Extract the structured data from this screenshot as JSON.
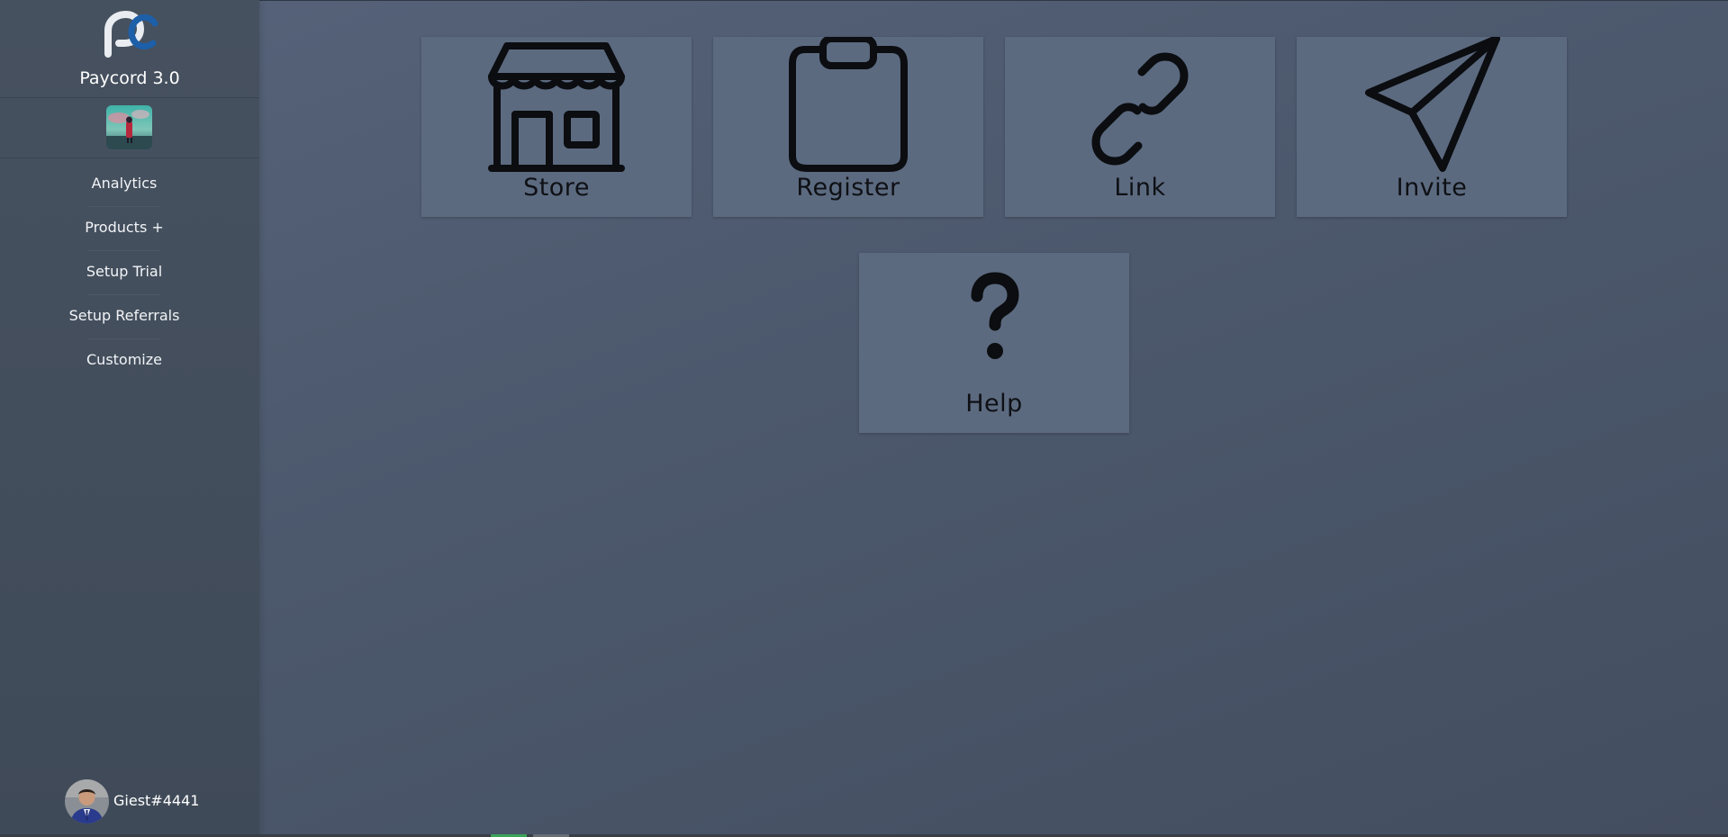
{
  "app": {
    "name": "Paycord 3.0"
  },
  "sidebar": {
    "items": [
      {
        "label": "Analytics"
      },
      {
        "label": "Products +"
      },
      {
        "label": "Setup Trial"
      },
      {
        "label": "Setup Referrals"
      },
      {
        "label": "Customize"
      }
    ]
  },
  "user": {
    "name": "Giest#4441"
  },
  "tiles": [
    {
      "label": "Store",
      "icon": "store-icon"
    },
    {
      "label": "Register",
      "icon": "clipboard-icon"
    },
    {
      "label": "Link",
      "icon": "link-icon"
    },
    {
      "label": "Invite",
      "icon": "paper-plane-icon"
    },
    {
      "label": "Help",
      "icon": "question-mark-icon"
    }
  ],
  "colors": {
    "background": "#4c586c",
    "sidebar": "#434e5c",
    "tile": "#5c6a80",
    "logo_accent": "#1d5fa8"
  }
}
